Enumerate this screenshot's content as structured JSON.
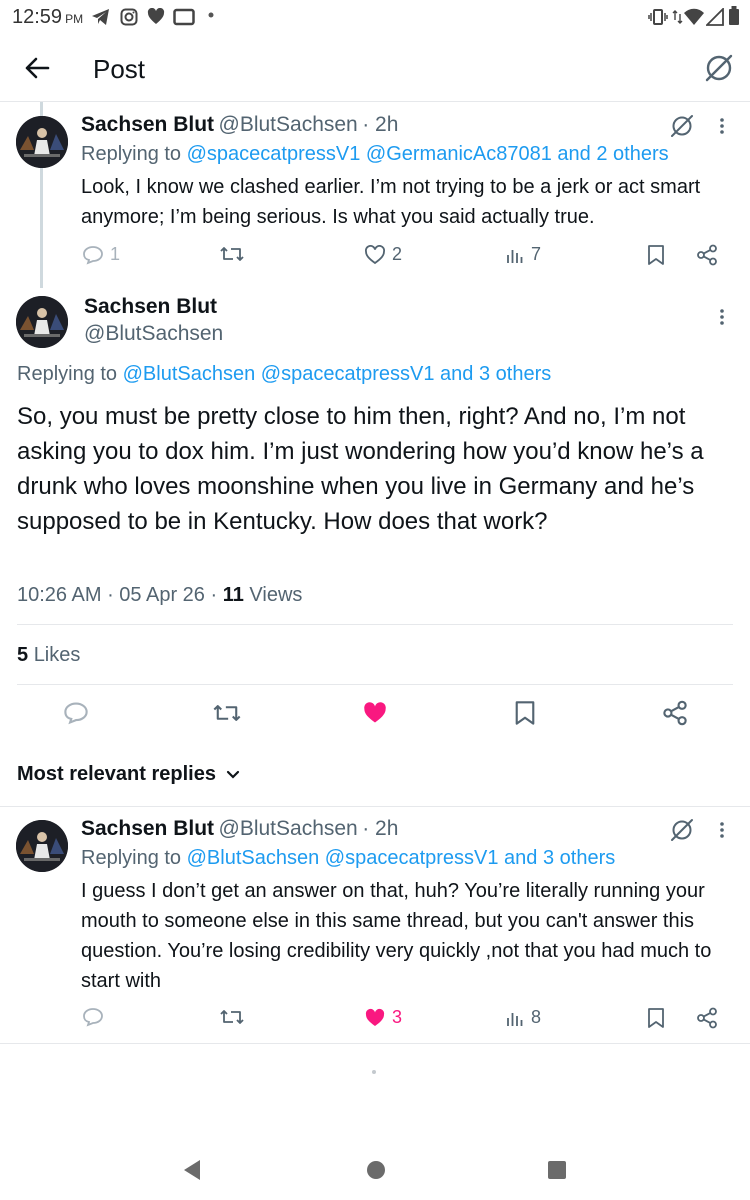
{
  "status": {
    "time": "12:59",
    "ampm": "PM"
  },
  "header": {
    "title": "Post"
  },
  "parent": {
    "name": "Sachsen Blut",
    "handle": "@BlutSachsen",
    "age": "· 2h",
    "replying_prefix": "Replying to",
    "replying_to": "@spacecatpressV1 @GermanicAc87081 and 2 others",
    "text": "Look, I know we clashed earlier. I’m not trying to be a jerk or act smart anymore; I’m being serious. Is what you said actually true.",
    "replies": "1",
    "likes": "2",
    "views": "7"
  },
  "main": {
    "name": "Sachsen Blut",
    "handle": "@BlutSachsen",
    "replying_prefix": "Replying to",
    "replying_to": "@BlutSachsen @spacecatpressV1 and 3 others",
    "text": "So, you must be pretty close to him then, right? And no, I’m not asking you to dox him. I’m just wondering how you’d know he’s a drunk who loves moonshine when you live in Germany and he’s supposed to be in Kentucky. How does that work?",
    "time": "10:26 AM",
    "date": "05 Apr 26",
    "views_count": "11",
    "views_label": "Views",
    "likes_count": "5",
    "likes_label": "Likes"
  },
  "sort": {
    "label": "Most relevant replies"
  },
  "reply": {
    "name": "Sachsen Blut",
    "handle": "@BlutSachsen",
    "age": "· 2h",
    "replying_prefix": "Replying to",
    "replying_to": "@BlutSachsen @spacecatpressV1 and 3 others",
    "text": "I guess I don’t get an answer on that, huh? You’re literally running your mouth to someone else in this same thread, but you can't answer this question. You’re losing credibility very quickly ,not that you had much to start with",
    "likes": "3",
    "views": "8"
  },
  "colors": {
    "accent": "#1d9bf0",
    "like": "#f91880",
    "muted": "#536471"
  },
  "icons": [
    "telegram-icon",
    "instagram-icon",
    "heart-icon",
    "cast-icon",
    "vibrate-icon",
    "wifi-icon",
    "signal-icon",
    "battery-icon",
    "back-arrow-icon",
    "grok-icon",
    "more-icon",
    "reply-icon",
    "retweet-icon",
    "like-icon",
    "views-icon",
    "bookmark-icon",
    "share-icon",
    "chevron-down-icon"
  ]
}
